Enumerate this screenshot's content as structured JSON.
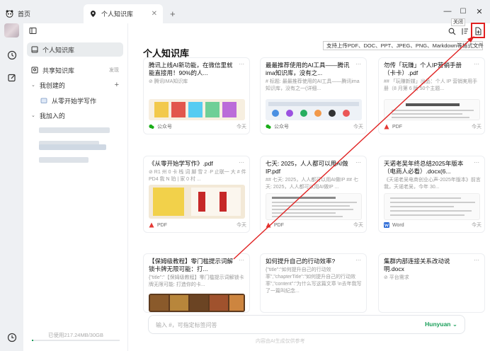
{
  "titlebar": {
    "home_tab": "首页",
    "active_tab": "个人知识库",
    "new_tab": "+",
    "min": "—",
    "max": "☐",
    "close": "✕"
  },
  "sidebar": {
    "personal_kb": "个人知识库",
    "shared_kb": "共享知识库",
    "discover": "发现",
    "created_by_me": "我创建的",
    "add": "+",
    "kb_item": "从零开始学写作",
    "joined": "我加入的",
    "usage": "已使用217.24MB/30GB"
  },
  "main": {
    "page_title": "个人知识库",
    "tooltip": "支持上传PDF、DOC、PPT、JPEG、PNG、Markdown等格式文件",
    "close_tip": "关闭",
    "cards": [
      {
        "title": "腾讯上线AI新功能，在微信里就能直接用！90%的人...",
        "snippet": "⊘ 腾讯IMA知识库",
        "type": "公众号",
        "date": "今天"
      },
      {
        "title": "最最推荐使用的AI工具——腾讯ima知识库，没有之...",
        "snippet": "# 标题: 最最推荐使用的AI工具——腾讯ima知识库，没有之一(详细...",
        "type": "公众号",
        "date": "今天"
      },
      {
        "title": "勿传「玩赚」个人IP营销手册（卡卡）.pdf",
        "snippet": "## 「玩赚新媒」出品：个人 IP 营销実用手册（8 月第 6 版 50个主题...",
        "type": "PDF",
        "date": "今天"
      },
      {
        "title": "《从零开始学写作》.pdf",
        "snippet": "⊘ R1 州 0 卡 栈 词 脚 雪 2 ·P 止联一 大 # 件 PD4 我 N 珀 | 家 0 村 ...",
        "type": "PDF",
        "date": "今天"
      },
      {
        "title": "七天: 2025，人人都可以用AI做IP.pdf",
        "snippet": "## 七天: 2025，人人都可以用AI做IP ## 七天: 2025，人人都可以用AI做IP ...",
        "type": "PDF",
        "date": "今天"
      },
      {
        "title": "天诺老吴年终总结2025年版本（电商人必看）.docx(6...",
        "snippet": "《天诺老吴电商创业心声-2025年版本》前言 我，天诺老吴，今年 30...",
        "type": "Word",
        "date": "今天"
      },
      {
        "title": "【保姆级教程】零门槛提示词解锁卡牌无限可能：打...",
        "snippet": "{\"title\":\"【保姆级教程】零门槛提示词解锁卡牌无限可能: 打造你的卡...",
        "type": "",
        "date": ""
      },
      {
        "title": "如何提升自己的行动效率?",
        "snippet": "{\"title\":\"如何提升自己的行动效率\",\"chapterTitle\":\"如何提升自己的行动效率\",\"content\":\"为什么写这篇文章 \\n去年我写了一篇叫纪念...",
        "type": "",
        "date": ""
      },
      {
        "title": "集群内部连接关系改动说明.docx",
        "snippet": "⊘ 平台需求",
        "type": "",
        "date": ""
      }
    ],
    "input_placeholder": "输入 #，可指定标签问答",
    "model": "Hunyuan ⌄",
    "disclaimer": "内容由AI生成仅供参考"
  },
  "colors": {
    "accent": "#1a9f5a",
    "highlight": "#e02020",
    "pdf": "#e53935",
    "word": "#2b6bd6",
    "wechat": "#1aad19"
  }
}
